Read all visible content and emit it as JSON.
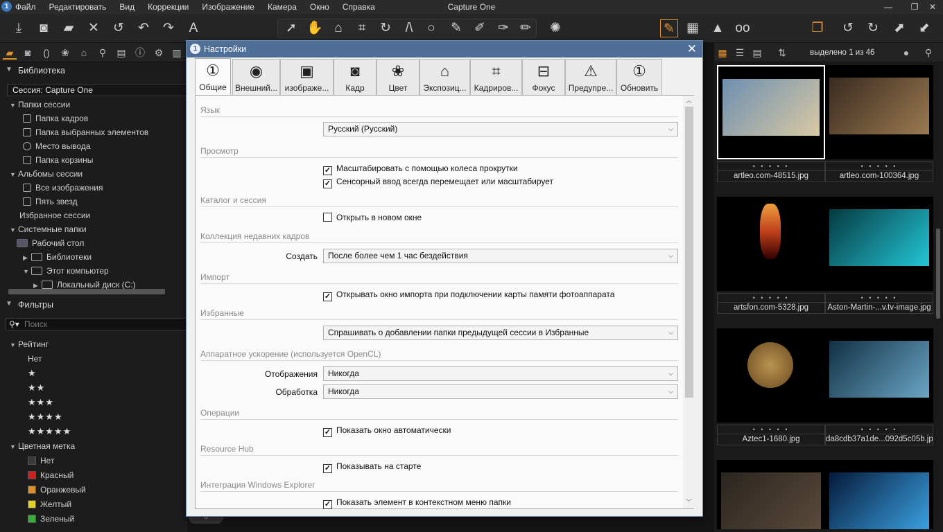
{
  "app": {
    "title": "Capture One",
    "menu": [
      "Файл",
      "Редактировать",
      "Вид",
      "Коррекции",
      "Изображение",
      "Камера",
      "Окно",
      "Справка"
    ]
  },
  "library": {
    "header": "Библиотека",
    "session": "Сессия: Capture One",
    "session_folders_header": "Папки сессии",
    "session_folders": [
      "Папка кадров",
      "Папка выбранных элементов",
      "Место вывода",
      "Папка корзины"
    ],
    "session_albums_header": "Альбомы сессии",
    "session_albums": [
      "Все изображения",
      "Пять звезд"
    ],
    "favorites": "Избранное сессии",
    "system_folders_header": "Системные папки",
    "desktop": "Рабочий стол",
    "libraries": "Библиотеки",
    "this_pc": "Этот компьютер",
    "local_disk": "Локальный диск (C:)"
  },
  "filters": {
    "header": "Фильтры",
    "search_placeholder": "Поиск",
    "rating_header": "Рейтинг",
    "rating_none": "Нет",
    "ratings": [
      "★",
      "★★",
      "★★★",
      "★★★★",
      "★★★★★"
    ],
    "color_header": "Цветная метка",
    "colors": [
      {
        "label": "Нет",
        "color": "#3a3a3a"
      },
      {
        "label": "Красный",
        "color": "#d02020"
      },
      {
        "label": "Оранжевый",
        "color": "#e0902a"
      },
      {
        "label": "Желтый",
        "color": "#e3cf2a"
      },
      {
        "label": "Зеленый",
        "color": "#3aae3a"
      }
    ],
    "bottom_value": "0"
  },
  "browser": {
    "selection": "выделено 1 из 46",
    "thumbnails": [
      {
        "name": "artleo.com-48515.jpg",
        "selected": true,
        "colors": [
          "#6d8fb0",
          "#d9c9a4"
        ]
      },
      {
        "name": "artleo.com-100364.jpg",
        "selected": false,
        "colors": [
          "#3a2a20",
          "#9a7a50"
        ]
      },
      {
        "name": "artsfon.com-5328.jpg",
        "selected": false,
        "colors": [
          "#0a0a0a",
          "#c0401a"
        ]
      },
      {
        "name": "Aston-Martin-...v.tv-image.jpg",
        "selected": false,
        "colors": [
          "#063a40",
          "#22c6d6"
        ]
      },
      {
        "name": "Aztec1-1680.jpg",
        "selected": false,
        "colors": [
          "#050505",
          "#b89450"
        ]
      },
      {
        "name": "da8cdb37a1de...092d5c05b.jpg",
        "selected": false,
        "colors": [
          "#123044",
          "#6aa6c4"
        ]
      },
      {
        "name": "",
        "selected": false,
        "colors": [
          "#2a2520",
          "#5a4a3a"
        ]
      },
      {
        "name": "",
        "selected": false,
        "colors": [
          "#061a3a",
          "#3aa0e0"
        ]
      }
    ],
    "meta_dots": "• • • • •"
  },
  "dialog": {
    "title": "Настройки",
    "close": "✕",
    "tabs": [
      {
        "label": "Общие",
        "icon": "①"
      },
      {
        "label": "Внешний...",
        "icon": "◉"
      },
      {
        "label": "изображе...",
        "icon": "▣"
      },
      {
        "label": "Кадр",
        "icon": "◙"
      },
      {
        "label": "Цвет",
        "icon": "❀"
      },
      {
        "label": "Экспозиц...",
        "icon": "⌂"
      },
      {
        "label": "Кадриров...",
        "icon": "⌗"
      },
      {
        "label": "Фокус",
        "icon": "⊟"
      },
      {
        "label": "Предупре...",
        "icon": "⚠"
      },
      {
        "label": "Обновить",
        "icon": "①"
      }
    ],
    "groups": {
      "language": "Язык",
      "view": "Просмотр",
      "catalog": "Каталог и сессия",
      "recent": "Коллекция недавних кадров",
      "import": "Импорт",
      "favorites": "Избранные",
      "hardware": "Аппаратное ускорение (используется OpenCL)",
      "operations": "Операции",
      "resource_hub": "Resource Hub",
      "explorer": "Интеграция Windows Explorer"
    },
    "language_value": "Русский (Русский)",
    "view_cb1": "Масштабировать с помощью колеса прокрутки",
    "view_cb2": "Сенсорный ввод всегда перемещает или масштабирует",
    "catalog_cb": "Открыть в новом окне",
    "create_label": "Создать",
    "create_value": "После более чем 1 час бездействия",
    "import_cb": "Открывать окно импорта при подключении карты памяти фотоаппарата",
    "favorites_value": "Спрашивать о добавлении папки предыдущей сессии в Избранные",
    "display_label": "Отображения",
    "display_value": "Никогда",
    "processing_label": "Обработка",
    "processing_value": "Никогда",
    "operations_cb": "Показать окно автоматически",
    "resource_cb": "Показывать на старте",
    "explorer_cb": "Показать элемент в контекстном меню папки",
    "checkmark": "✓"
  },
  "colors": {
    "accent": "#e8912d",
    "dialog_title": "#4f6f98"
  }
}
